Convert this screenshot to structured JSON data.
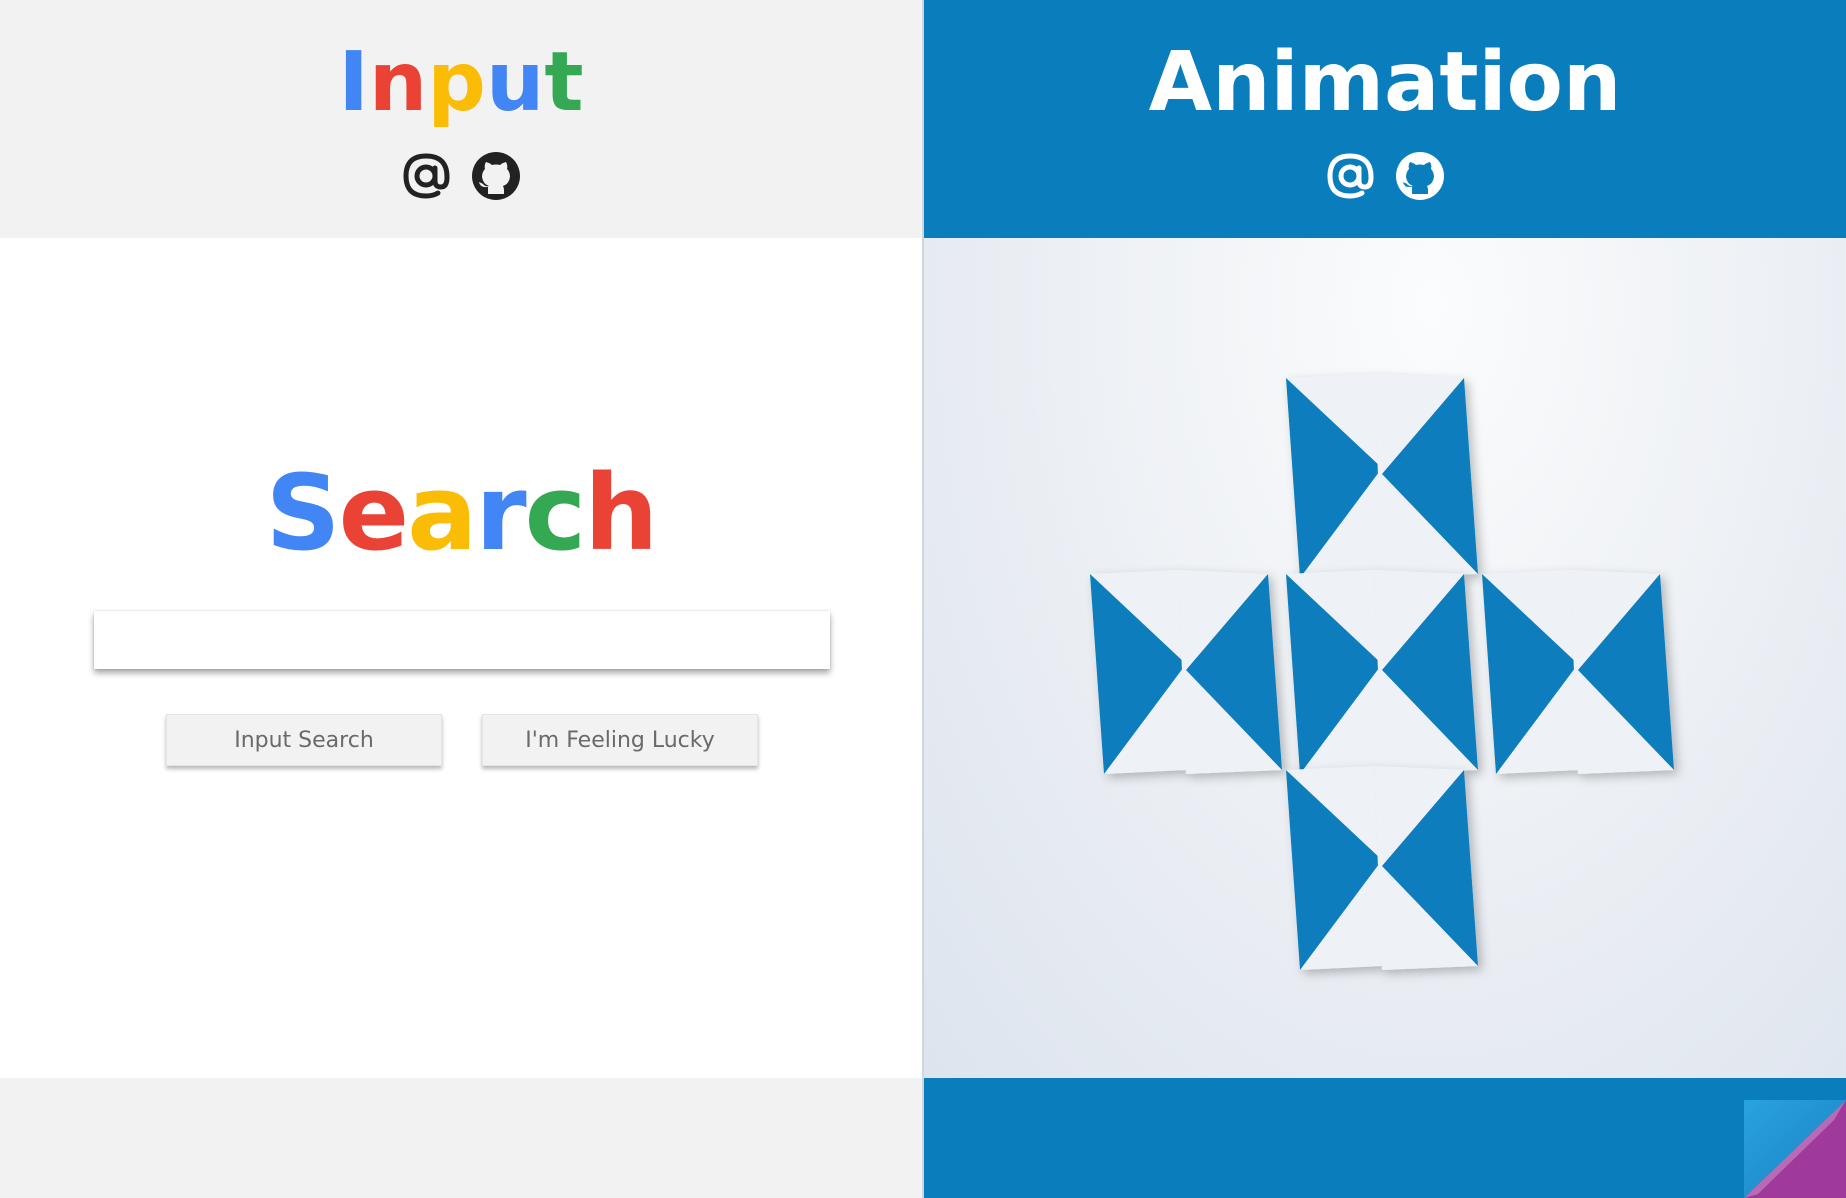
{
  "left": {
    "title_letters": [
      {
        "ch": "I",
        "color": "#4285f4"
      },
      {
        "ch": "n",
        "color": "#ea4335"
      },
      {
        "ch": "p",
        "color": "#fbbc05"
      },
      {
        "ch": "u",
        "color": "#4285f4"
      },
      {
        "ch": "t",
        "color": "#34a853"
      }
    ],
    "icons": [
      "at-sign-icon",
      "github-icon"
    ],
    "icon_color": "#222222",
    "search_letters": [
      {
        "ch": "S",
        "color": "#4285f4"
      },
      {
        "ch": "e",
        "color": "#ea4335"
      },
      {
        "ch": "a",
        "color": "#fbbc05"
      },
      {
        "ch": "r",
        "color": "#4285f4"
      },
      {
        "ch": "c",
        "color": "#34a853"
      },
      {
        "ch": "h",
        "color": "#ea4335"
      }
    ],
    "search_input": {
      "value": "",
      "placeholder": ""
    },
    "buttons": {
      "search": "Input Search",
      "lucky": "I'm Feeling Lucky"
    }
  },
  "right": {
    "title": "Animation",
    "icons": [
      "at-sign-icon",
      "github-icon"
    ],
    "icon_color": "#ffffff",
    "accent": "#0a7dbd",
    "tile_light": "#eef2f6",
    "fold_colors": [
      "#29a3e0",
      "#a0399c"
    ]
  }
}
